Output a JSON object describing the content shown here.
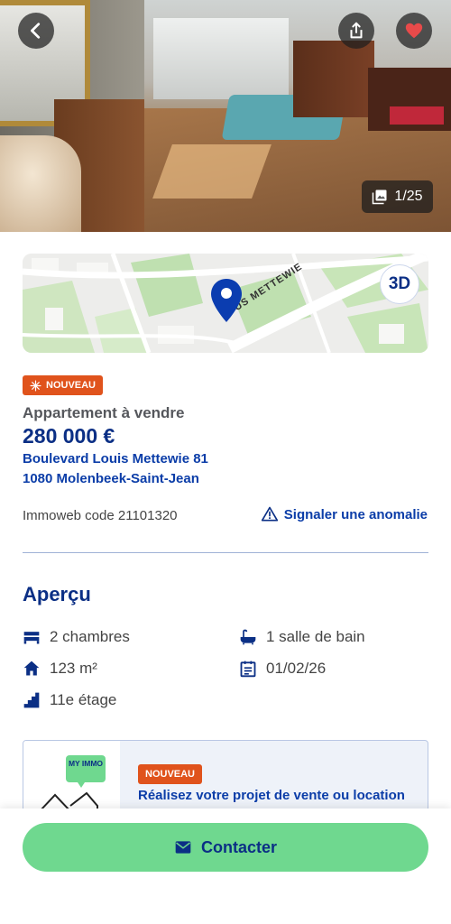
{
  "header": {
    "photo_counter": "1/25"
  },
  "map": {
    "street_label": "US METTEWIE",
    "view_3d_label": "3D"
  },
  "listing": {
    "badge_new": "NOUVEAU",
    "property_type": "Appartement à vendre",
    "price": "280 000 €",
    "address_line1": "Boulevard Louis Mettewie 81",
    "address_line2": "1080 Molenbeek-Saint-Jean",
    "immoweb_code": "Immoweb code 21101320",
    "report_label": "Signaler une anomalie"
  },
  "overview": {
    "title": "Aperçu",
    "bedrooms": "2 chambres",
    "bathrooms": "1 salle de bain",
    "area": "123 m²",
    "availability": "01/02/26",
    "floor": "11e étage"
  },
  "promo": {
    "illustration_sign": "MY IMMO",
    "badge": "NOUVEAU",
    "text": "Réalisez votre projet de vente ou location"
  },
  "footer": {
    "contact_label": "Contacter"
  },
  "colors": {
    "brand_blue": "#0b2f85",
    "accent_orange": "#e0531c",
    "contact_green": "#6fd88f",
    "favorite_red": "#e84a4a"
  }
}
